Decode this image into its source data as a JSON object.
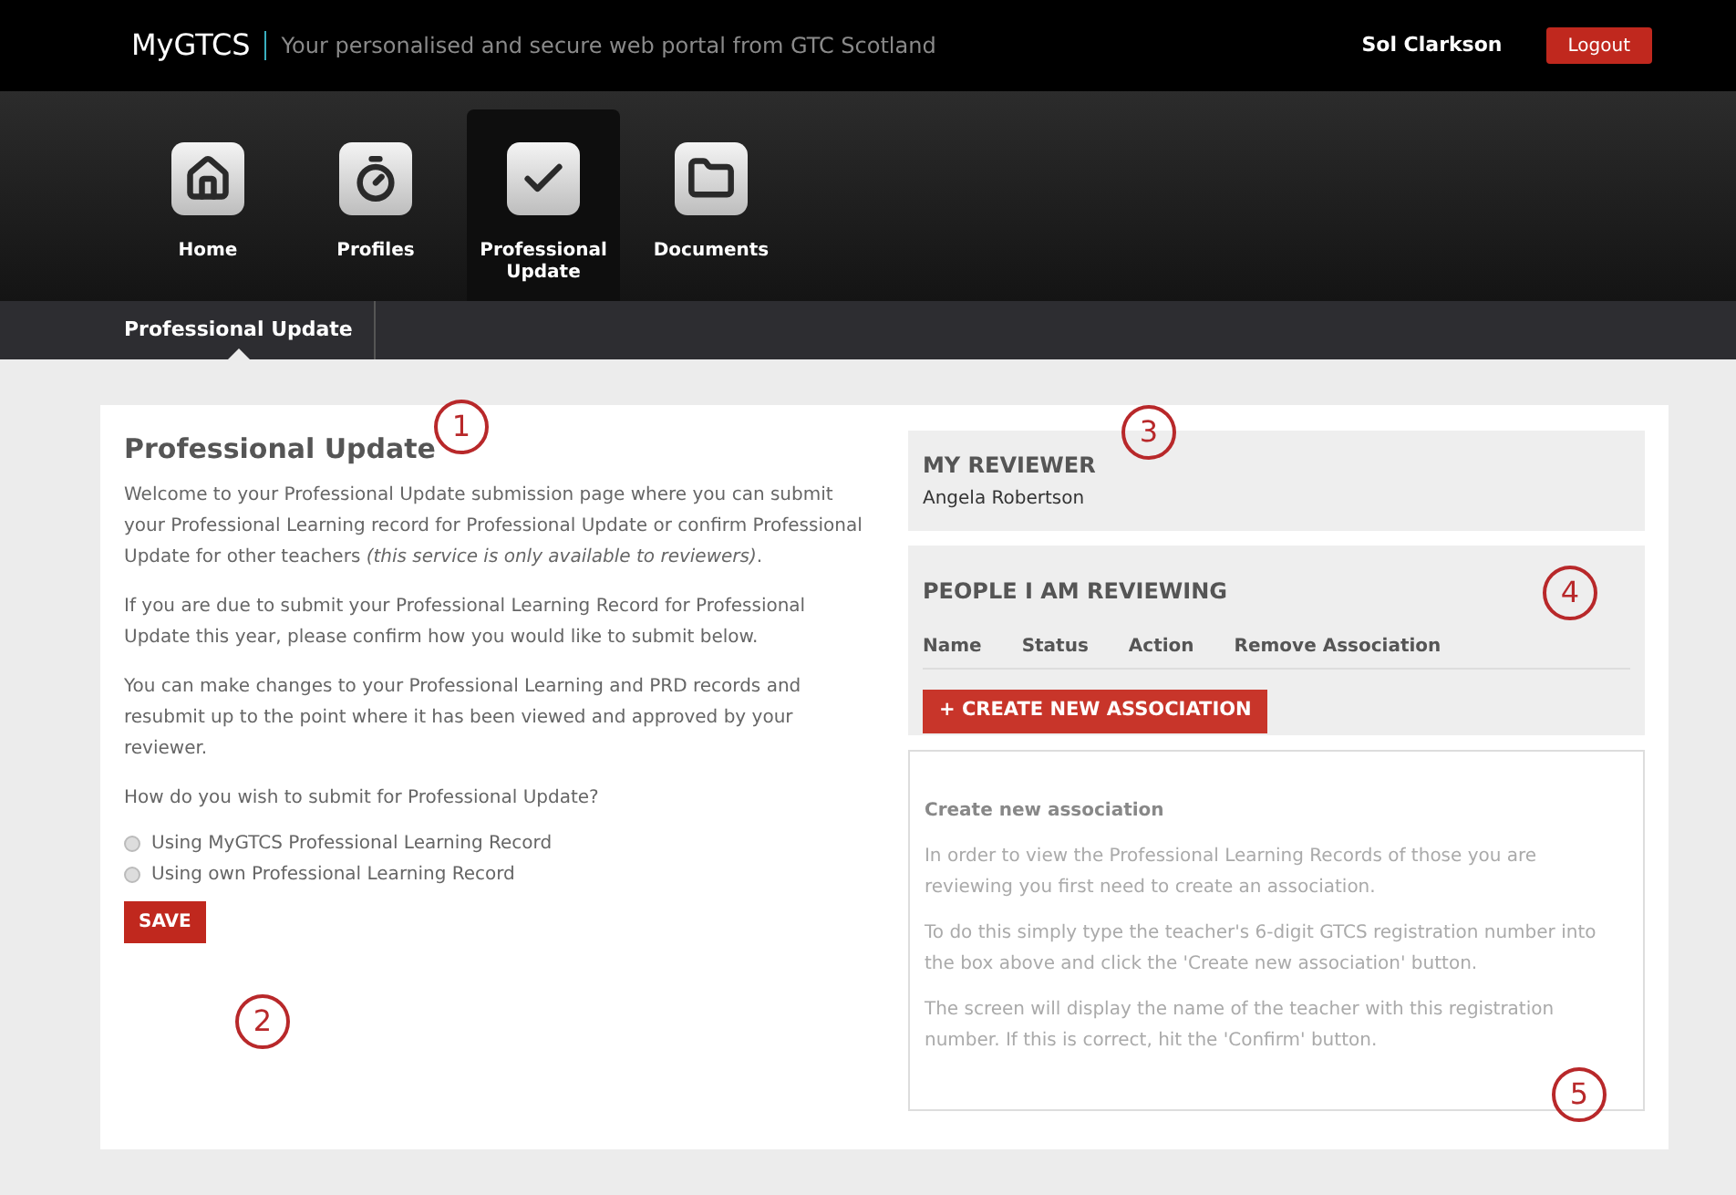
{
  "header": {
    "logo": "MyGTCS",
    "tagline": "Your personalised and secure web portal from GTC Scotland",
    "user": "Sol Clarkson",
    "logout": "Logout"
  },
  "nav": [
    {
      "label": "Home",
      "selected": false
    },
    {
      "label": "Profiles",
      "selected": false
    },
    {
      "label": "Professional Update",
      "selected": true
    },
    {
      "label": "Documents",
      "selected": false
    }
  ],
  "subnav": [
    {
      "label": "Professional Update",
      "selected": true
    }
  ],
  "main": {
    "title": "Professional Update",
    "paragraphs": [
      "Welcome to your Professional Update submission page where you can submit your Professional Learning record for Professional Update or confirm Professional Update for other teachers *(this service is only available to reviewers)*.",
      "If you are due to submit your Professional Learning Record for Professional Update this year, please confirm how you would like to submit below.",
      "You can make changes to your Professional Learning and PRD records and resubmit up to the point where it has been viewed and approved by your reviewer."
    ],
    "question": "How do you wish to submit for Professional Update?",
    "options": [
      {
        "label": "Using MyGTCS Professional Learning Record",
        "selected": false
      },
      {
        "label": "Using own Professional Learning Record",
        "selected": false
      }
    ],
    "save": "SAVE"
  },
  "reviewer": {
    "title": "MY REVIEWER",
    "name": "Angela Robertson"
  },
  "reviewing": {
    "title": "PEOPLE I AM REVIEWING",
    "columns": [
      "Name",
      "Status",
      "Action",
      "Remove Association"
    ],
    "button": "+ CREATE NEW ASSOCIATION"
  },
  "help": {
    "title": "Create new association",
    "paragraphs": [
      "In order to view the Professional Learning Records of those you are reviewing you first need to create an association.",
      "To do this simply type the teacher's 6-digit GTCS registration number into the box above and click the 'Create new association' button.",
      "The screen will display the name of the teacher with this registration number. If this is correct, hit the 'Confirm' button."
    ]
  },
  "callouts": [
    "1",
    "2",
    "3",
    "4",
    "5"
  ]
}
